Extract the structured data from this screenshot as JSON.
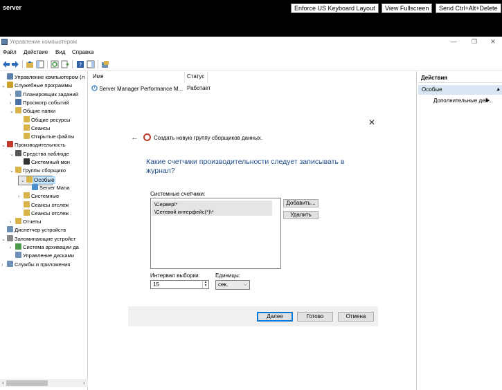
{
  "session": {
    "name": "server",
    "buttons": [
      "Enforce US Keyboard Layout",
      "View Fullscreen",
      "Send Ctrl+Alt+Delete"
    ]
  },
  "window": {
    "title": "Управление компьютером",
    "controls": [
      "—",
      "❐",
      "✕"
    ]
  },
  "menu": [
    "Файл",
    "Действие",
    "Вид",
    "Справка"
  ],
  "tree": [
    {
      "label": "Управление компьютером (л",
      "level": 0,
      "toggle": "",
      "color": "#5b7fa8"
    },
    {
      "label": "Служебные программы",
      "level": 0,
      "toggle": "v",
      "color": "#c9a227"
    },
    {
      "label": "Планировщик заданий",
      "level": 1,
      "toggle": ">",
      "color": "#6d8fb5"
    },
    {
      "label": "Просмотр событий",
      "level": 1,
      "toggle": ">",
      "color": "#4a6fa5"
    },
    {
      "label": "Общие папки",
      "level": 1,
      "toggle": "v",
      "color": "#d9b44a"
    },
    {
      "label": "Общие ресурсы",
      "level": 2,
      "toggle": "",
      "color": "#d9b44a"
    },
    {
      "label": "Сеансы",
      "level": 2,
      "toggle": "",
      "color": "#d9b44a"
    },
    {
      "label": "Открытые файлы",
      "level": 2,
      "toggle": "",
      "color": "#d9b44a"
    },
    {
      "label": "Производительность",
      "level": 0,
      "toggle": "v",
      "color": "#c0392b"
    },
    {
      "label": "Средства наблюде",
      "level": 1,
      "toggle": "v",
      "color": "#555555"
    },
    {
      "label": "Системный мон",
      "level": 2,
      "toggle": "",
      "color": "#333333"
    },
    {
      "label": "Группы сборщико",
      "level": 1,
      "toggle": "v",
      "color": "#d9b44a"
    },
    {
      "label": "Особые",
      "level": 2,
      "toggle": "v",
      "color": "#d9b44a",
      "selected": true
    },
    {
      "label": "Server Mana",
      "level": 3,
      "toggle": "",
      "color": "#4a8fc9"
    },
    {
      "label": "Системные",
      "level": 2,
      "toggle": ">",
      "color": "#d9b44a"
    },
    {
      "label": "Сеансы отслеж",
      "level": 2,
      "toggle": "",
      "color": "#d9b44a"
    },
    {
      "label": "Сеансы отслеж",
      "level": 2,
      "toggle": "",
      "color": "#d9b44a"
    },
    {
      "label": "Отчеты",
      "level": 1,
      "toggle": ">",
      "color": "#d9b44a"
    },
    {
      "label": "Диспетчер устройств",
      "level": 0,
      "toggle": "",
      "color": "#6d8fb5"
    },
    {
      "label": "Запоминающие устройст",
      "level": 0,
      "toggle": "v",
      "color": "#888888"
    },
    {
      "label": "Система архивации да",
      "level": 1,
      "toggle": ">",
      "color": "#4a9a4a"
    },
    {
      "label": "Управление дисками",
      "level": 1,
      "toggle": "",
      "color": "#6d8fb5"
    },
    {
      "label": "Службы и приложения",
      "level": 0,
      "toggle": ">",
      "color": "#6d8fb5"
    }
  ],
  "list": {
    "columns": [
      "Имя",
      "Статус"
    ],
    "rows": [
      {
        "name": "Server Manager Performance M...",
        "status": "Работает"
      }
    ]
  },
  "actions": {
    "header": "Действия",
    "section": "Особые",
    "items": [
      "Дополнительные дей..."
    ]
  },
  "wizard": {
    "back_glyph": "←",
    "close_glyph": "✕",
    "title": "Создать новую группу сборщиков данных.",
    "question": "Какие счетчики производительности следует записывать в журнал?",
    "counters_label": "Системные счетчики:",
    "counters": [
      "\\Сервер\\*",
      "\\Сетевой интерфейс(*)\\*"
    ],
    "add_label": "Добавить...",
    "remove_label": "Удалить",
    "interval_label": "Интервал выборки:",
    "interval_value": "15",
    "units_label": "Единицы:",
    "units_value": "сек.",
    "next_label": "Далее",
    "finish_label": "Готово",
    "cancel_label": "Отмена"
  }
}
